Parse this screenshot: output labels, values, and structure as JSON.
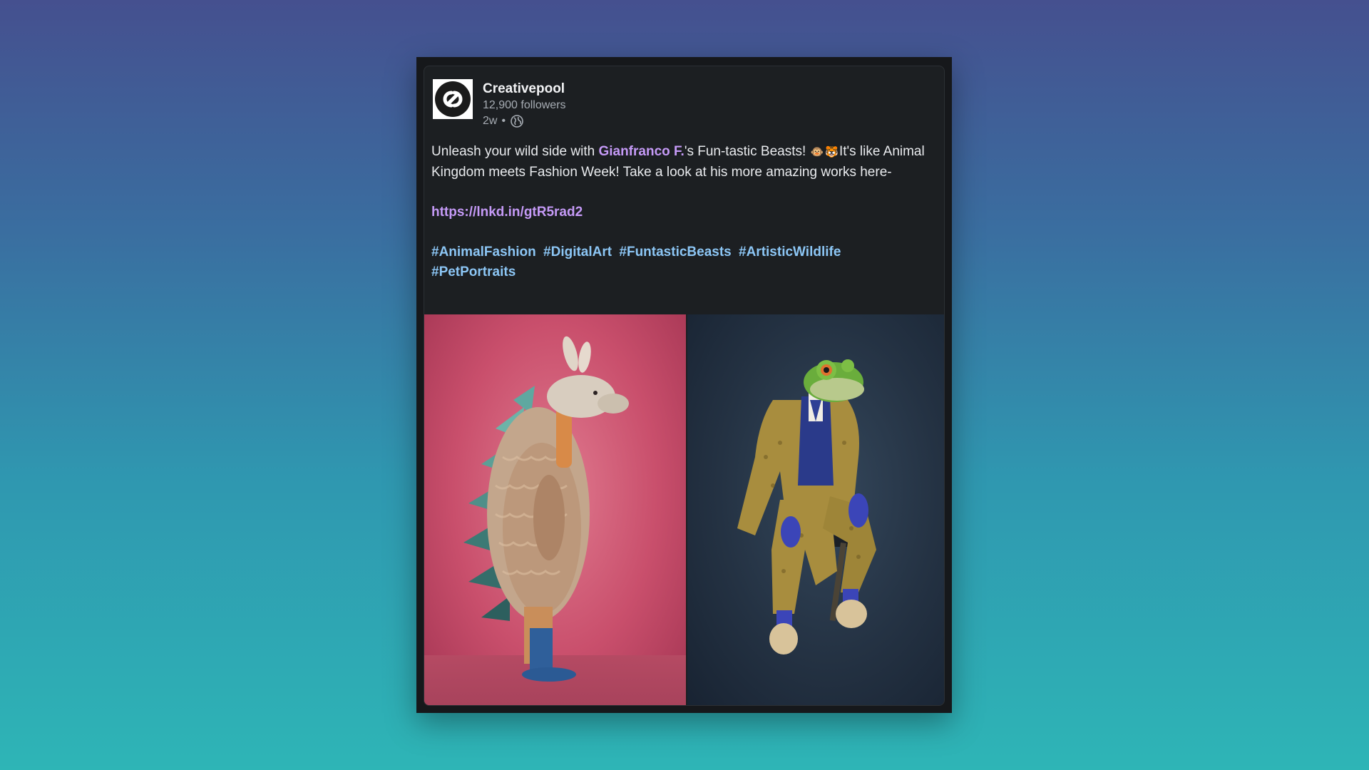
{
  "post": {
    "company": "Creativepool",
    "followers": "12,900 followers",
    "time": "2w",
    "separator": "•",
    "text_before": "Unleash your wild side with ",
    "mention": "Gianfranco F.",
    "text_after_mention": "'s Fun-tastic Beasts! ",
    "emoji_1": "🐵",
    "emoji_2": "🐯",
    "text_end": "It's like Animal Kingdom meets Fashion Week! Take a look at his more amazing works here-",
    "link": "https://lnkd.in/gtR5rad2",
    "hashtags": [
      "#AnimalFashion",
      "#DigitalArt",
      "#FuntasticBeasts",
      "#ArtisticWildlife",
      "#PetPortraits"
    ]
  },
  "images": {
    "left": "armadillo-fashion-image",
    "right": "frog-fashion-image"
  },
  "colors": {
    "card_bg": "#1c1f22",
    "mention": "#c59af7",
    "hashtag": "#8cc6f5",
    "text": "#e9ebee",
    "muted": "#a7adb4"
  },
  "icons": {
    "logo": "creativepool-logo-icon",
    "globe": "globe-icon"
  }
}
